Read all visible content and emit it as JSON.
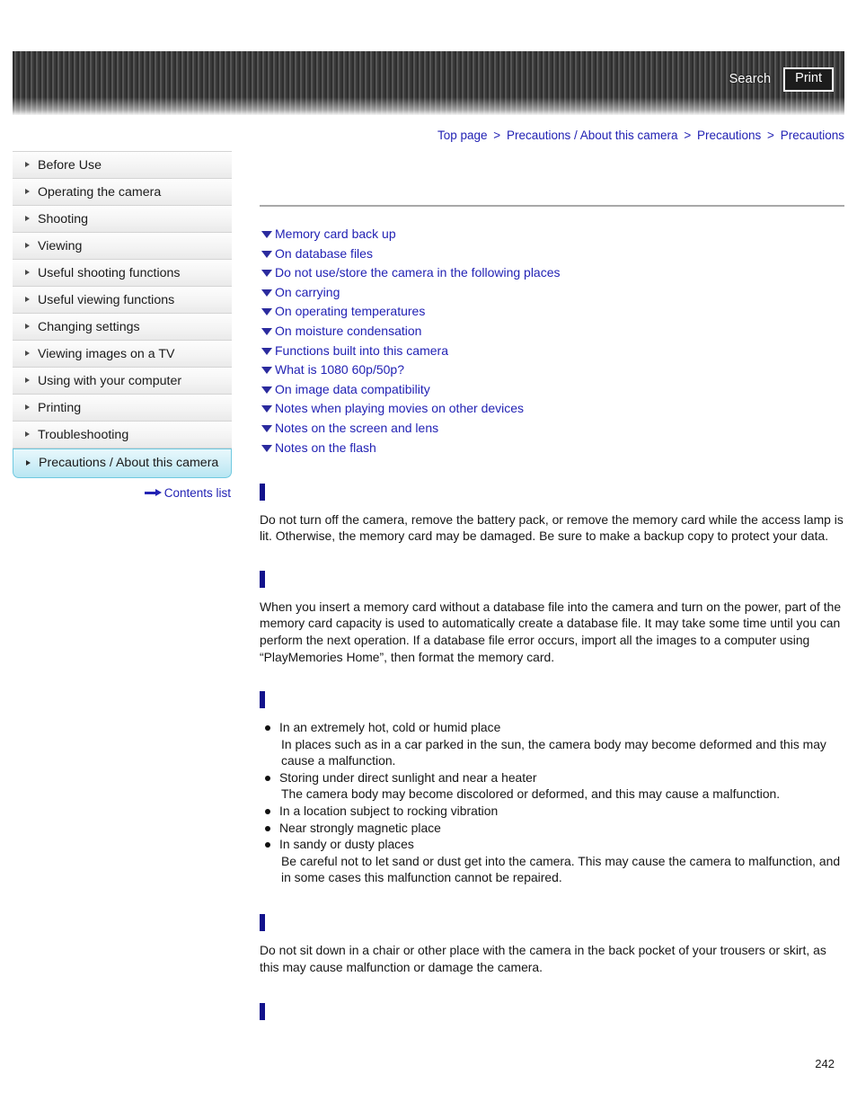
{
  "header": {
    "search_label": "Search",
    "print_label": "Print"
  },
  "breadcrumb": {
    "separator": ">",
    "items": [
      {
        "label": "Top page"
      },
      {
        "label": "Precautions / About this camera"
      },
      {
        "label": "Precautions"
      },
      {
        "label": "Precautions"
      }
    ]
  },
  "sidebar": {
    "items": [
      {
        "label": "Before Use",
        "active": false
      },
      {
        "label": "Operating the camera",
        "active": false
      },
      {
        "label": "Shooting",
        "active": false
      },
      {
        "label": "Viewing",
        "active": false
      },
      {
        "label": "Useful shooting functions",
        "active": false
      },
      {
        "label": "Useful viewing functions",
        "active": false
      },
      {
        "label": "Changing settings",
        "active": false
      },
      {
        "label": "Viewing images on a TV",
        "active": false
      },
      {
        "label": "Using with your computer",
        "active": false
      },
      {
        "label": "Printing",
        "active": false
      },
      {
        "label": "Troubleshooting",
        "active": false
      },
      {
        "label": "Precautions / About this camera",
        "active": true
      }
    ],
    "contents_list_label": "Contents list"
  },
  "main": {
    "anchor_links": [
      {
        "label": "Memory card back up"
      },
      {
        "label": "On database files"
      },
      {
        "label": "Do not use/store the camera in the following places"
      },
      {
        "label": "On carrying"
      },
      {
        "label": "On operating temperatures"
      },
      {
        "label": "On moisture condensation"
      },
      {
        "label": "Functions built into this camera"
      },
      {
        "label": "What is 1080 60p/50p?"
      },
      {
        "label": "On image data compatibility"
      },
      {
        "label": "Notes when playing movies on other devices"
      },
      {
        "label": "Notes on the screen and lens"
      },
      {
        "label": "Notes on the flash"
      }
    ],
    "sections": [
      {
        "heading": "",
        "paragraph": "Do not turn off the camera, remove the battery pack, or remove the memory card while the access lamp is lit. Otherwise, the memory card may be damaged. Be sure to make a backup copy to protect your data."
      },
      {
        "heading": "",
        "paragraph": "When you insert a memory card without a database file into the camera and turn on the power, part of the memory card capacity is used to automatically create a database file. It may take some time until you can perform the next operation. If a database file error occurs, import all the images to a computer using “PlayMemories Home”, then format the memory card."
      },
      {
        "heading": "",
        "bullets": [
          {
            "label": "In an extremely hot, cold or humid place",
            "detail": "In places such as in a car parked in the sun, the camera body may become deformed and this may cause a malfunction."
          },
          {
            "label": "Storing under direct sunlight and near a heater",
            "detail": "The camera body may become discolored or deformed, and this may cause a malfunction."
          },
          {
            "label": "In a location subject to rocking vibration",
            "detail": ""
          },
          {
            "label": "Near strongly magnetic place",
            "detail": ""
          },
          {
            "label": "In sandy or dusty places",
            "detail": "Be careful not to let sand or dust get into the camera. This may cause the camera to malfunction, and in some cases this malfunction cannot be repaired."
          }
        ]
      },
      {
        "heading": "",
        "paragraph": "Do not sit down in a chair or other place with the camera in the back pocket of your trousers or skirt, as this may cause malfunction or damage the camera."
      },
      {
        "heading": "",
        "paragraph": ""
      }
    ]
  },
  "footer": {
    "page_number": "242"
  },
  "colors": {
    "link": "#2222b4",
    "heading_bar": "#12128c",
    "active_nav": "#b8e6f2",
    "rule": "#a8a8a8"
  }
}
